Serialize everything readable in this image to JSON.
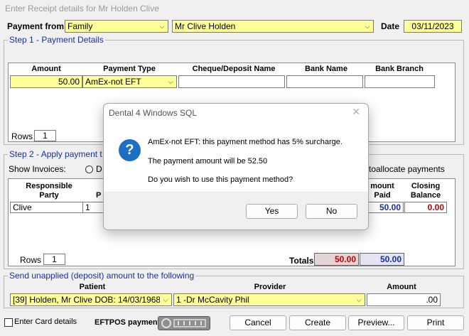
{
  "window": {
    "title": "Enter Receipt details for Mr  Holden  Clive"
  },
  "header": {
    "payment_from_label": "Payment from",
    "payment_from_value": "Family",
    "patient_value": "Mr Clive  Holden",
    "date_label": "Date",
    "date_value": "03/11/2023"
  },
  "step1": {
    "title": "Step 1 - Payment Details",
    "columns": [
      "Amount",
      "Payment Type",
      "Cheque/Deposit Name",
      "Bank Name",
      "Bank Branch"
    ],
    "row": {
      "amount": "50.00",
      "payment_type": "AmEx-not EFT",
      "cheque_name": "",
      "bank_name": "",
      "bank_branch": ""
    },
    "rows_label": "Rows",
    "rows_value": "1"
  },
  "step2": {
    "title": "Step 2 - Apply payment t",
    "show_invoices_label": "Show Invoices:",
    "radio_partial_label": "D",
    "autoallocate_label": "toallocate payments",
    "col_responsible_party": "Responsible Party",
    "col_p": "P",
    "col_amount_paid": "mount Paid",
    "col_closing_balance": "Closing Balance",
    "row": {
      "party": "Clive",
      "p": "1",
      "amount_paid": "50.00",
      "closing_balance": "0.00"
    },
    "rows_label": "Rows",
    "rows_value": "1",
    "totals_label": "Totals",
    "total_red": "50.00",
    "total_blue": "50.00"
  },
  "step3": {
    "title": "Send unapplied (deposit) amount to the following",
    "col_patient": "Patient",
    "col_provider": "Provider",
    "col_amount": "Amount",
    "patient_value": "[39] Holden, Mr Clive DOB: 14/03/1968",
    "provider_value": "1 -Dr McCavity Phil",
    "amount_value": ".00"
  },
  "footer": {
    "card_details_label": "Enter Card details",
    "eftpos_label": "EFTPOS payment",
    "cancel_label": "Cancel",
    "create_label": "Create",
    "preview_label": "Preview...",
    "print_label": "Print"
  },
  "dialog": {
    "title": "Dental 4 Windows SQL",
    "line1": "AmEx-not EFT: this payment method has 5% surcharge.",
    "line2": "The payment amount will be 52.50",
    "line3": "Do you wish to use this payment method?",
    "yes_label": "Yes",
    "no_label": "No"
  },
  "colors": {
    "yellow_field": "#ffff99",
    "blue_text": "#1a2fa0",
    "red_text": "#c00000",
    "dialog_icon": "#1d6fc4"
  }
}
